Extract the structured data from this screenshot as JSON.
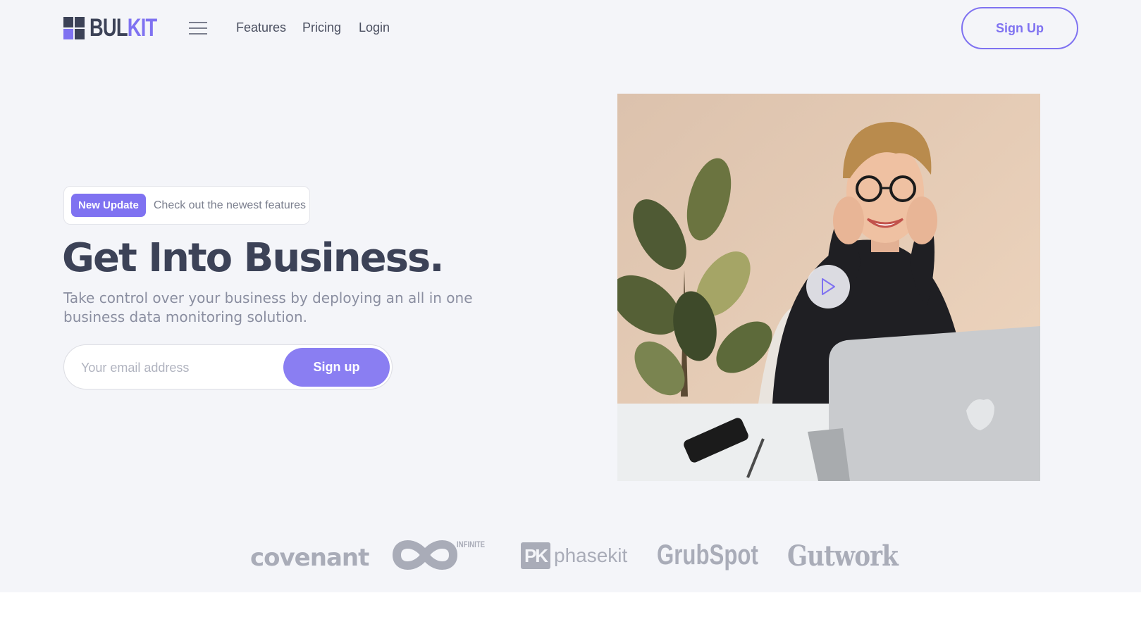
{
  "brand": {
    "logo_part1": "BUL",
    "logo_part2": "KIT"
  },
  "nav": {
    "links": [
      "Features",
      "Pricing",
      "Login"
    ],
    "signup_label": "Sign Up"
  },
  "hero": {
    "badge_label": "New Update",
    "badge_text": "Check out the newest features",
    "title": "Get Into Business.",
    "subtitle": "Take control over your business by deploying an all in one business data monitoring solution.",
    "email_placeholder": "Your email address",
    "signup_button": "Sign up"
  },
  "partners": {
    "logos": [
      "covenant",
      "INFINITE",
      "phasekit",
      "GrubSpot",
      "Gutwork"
    ],
    "phasekit_mark": "PK"
  },
  "colors": {
    "accent": "#7f72f1",
    "heading": "#3c4257",
    "background": "#f4f5f9",
    "muted": "#a9acb8"
  }
}
